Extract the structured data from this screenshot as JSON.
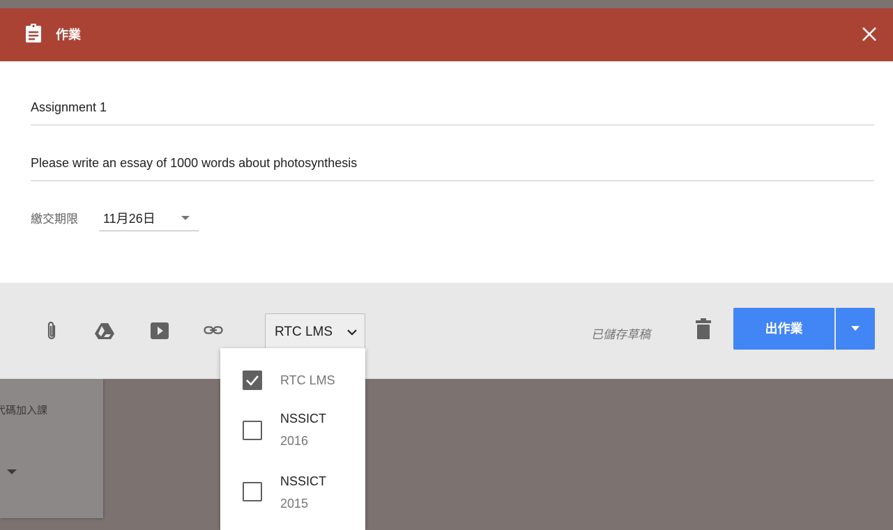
{
  "header": {
    "title": "作業",
    "icon": "assignment-icon",
    "background_color": "#ab4334"
  },
  "form": {
    "title_value": "Assignment 1",
    "description_value": "Please write an essay of 1000 words about photosynthesis",
    "due_label": "繳交期限",
    "due_value": "11月26日"
  },
  "toolbar": {
    "icons": [
      "attach-icon",
      "drive-icon",
      "youtube-icon",
      "link-icon"
    ],
    "class_select_label": "RTC LMS",
    "saved_text": "已儲存草稿",
    "assign_label": "出作業",
    "accent_color": "#4285f4"
  },
  "class_menu": {
    "items": [
      {
        "label": "RTC LMS",
        "sub": "",
        "checked": true
      },
      {
        "label": "NSSICT",
        "sub": "2016",
        "checked": false
      },
      {
        "label": "NSSICT",
        "sub": "2015",
        "checked": false
      }
    ]
  },
  "background": {
    "card_text": "代碼加入課"
  }
}
